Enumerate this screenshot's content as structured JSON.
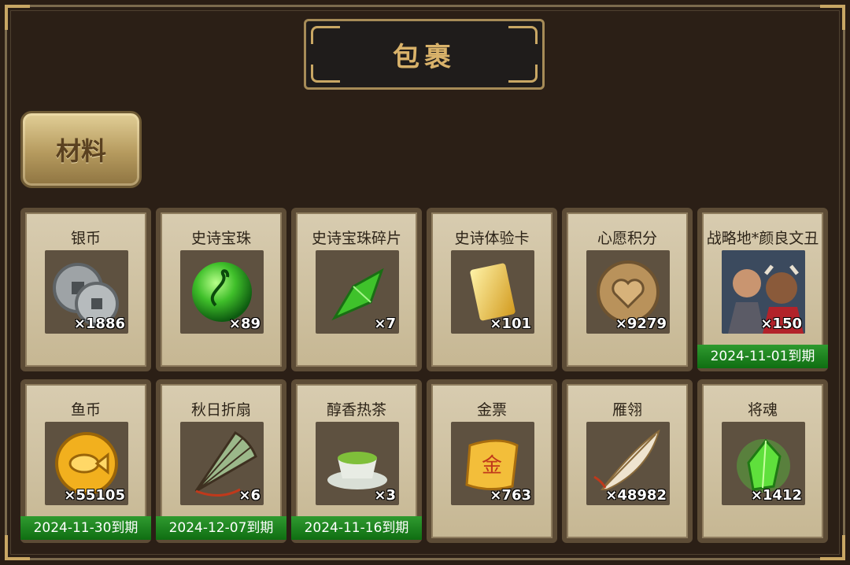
{
  "title": "包裹",
  "tab": {
    "label": "材料"
  },
  "colors": {
    "gold": "#d9b26a",
    "card_bg": "#d8ccb0",
    "expiry_green": "#1f8a22"
  },
  "items": [
    {
      "name": "银币",
      "qty": "×1886",
      "icon": "silver-coin-icon",
      "expiry": ""
    },
    {
      "name": "史诗宝珠",
      "qty": "×89",
      "icon": "green-orb-icon",
      "expiry": ""
    },
    {
      "name": "史诗宝珠碎片",
      "qty": "×7",
      "icon": "green-shard-icon",
      "expiry": ""
    },
    {
      "name": "史诗体验卡",
      "qty": "×101",
      "icon": "gold-card-icon",
      "expiry": ""
    },
    {
      "name": "心愿积分",
      "qty": "×9279",
      "icon": "heart-coin-icon",
      "expiry": ""
    },
    {
      "name": "战略地*颜良文丑",
      "qty": "×150",
      "icon": "general-portrait-icon",
      "expiry": "2024-11-01到期"
    },
    {
      "name": "鱼币",
      "qty": "×55105",
      "icon": "fish-coin-icon",
      "expiry": "2024-11-30到期"
    },
    {
      "name": "秋日折扇",
      "qty": "×6",
      "icon": "folding-fan-icon",
      "expiry": "2024-12-07到期"
    },
    {
      "name": "醇香热茶",
      "qty": "×3",
      "icon": "tea-cup-icon",
      "expiry": "2024-11-16到期"
    },
    {
      "name": "金票",
      "qty": "×763",
      "icon": "gold-ticket-icon",
      "expiry": ""
    },
    {
      "name": "雁翎",
      "qty": "×48982",
      "icon": "feather-icon",
      "expiry": ""
    },
    {
      "name": "将魂",
      "qty": "×1412",
      "icon": "soul-crystal-icon",
      "expiry": ""
    }
  ]
}
